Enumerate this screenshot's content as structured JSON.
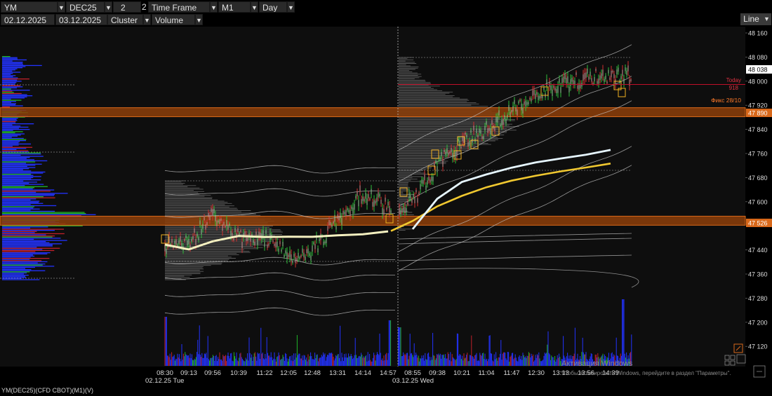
{
  "toolbar": {
    "symbol": "YM",
    "contract": "DEC25",
    "period_value": "2",
    "period_suffix": "2",
    "timeframe_label": "Time Frame",
    "interval": "M1",
    "range": "Day",
    "date_from": "02.12.2025",
    "date_to": "03.12.2025",
    "chart_mode": "Cluster",
    "cluster_value": "Volume",
    "style_button": "Line"
  },
  "price_axis": {
    "ticks": [
      "48 160",
      "48 080",
      "48 000",
      "47 920",
      "47 840",
      "47 760",
      "47 680",
      "47 600",
      "47 440",
      "47 360",
      "47 280",
      "47 200",
      "47 120"
    ],
    "current_price": "48 038",
    "level_upper": "47 890",
    "level_lower": "47 526"
  },
  "annotations": {
    "today_label": "Today",
    "today_value": "918",
    "fix_label": "Фикс 28/10"
  },
  "time_axis": {
    "labels": [
      "08:30",
      "09:13",
      "09:56",
      "10:39",
      "11:22",
      "12:05",
      "12:48",
      "13:31",
      "14:14",
      "14:57",
      "08:55",
      "09:38",
      "10:21",
      "11:04",
      "11:47",
      "12:30",
      "13:13",
      "13:56",
      "14:39"
    ],
    "date_labels": [
      "02.12.25 Tue",
      "03.12.25 Wed"
    ]
  },
  "watermark": {
    "title": "Активация Windows",
    "subtitle": "Чтобы активировать Windows, перейдите в раздел \"Параметры\"."
  },
  "status_bar": "YM(DEC25)(CFD CBOT)(M1)(V)",
  "colors": {
    "zone": "#b55a12",
    "vwap_white": "#e6f6ff",
    "vwap_yellow": "#f0c830",
    "today_line": "#c0102a",
    "fix_text": "#ff7a2a",
    "volume_blue": "#2233ff"
  },
  "chart_data": {
    "type": "line",
    "instrument": "YM DEC25",
    "timeframe": "M1",
    "ylim": [
      47240,
      48180
    ],
    "y_ticks": [
      48160,
      48080,
      48000,
      47920,
      47840,
      47760,
      47680,
      47600,
      47440,
      47360,
      47280,
      47200,
      47120
    ],
    "current_price": 48038,
    "zones": [
      {
        "label": "47 890",
        "low": 47882,
        "high": 47912
      },
      {
        "label": "47 526",
        "low": 47522,
        "high": 47552
      }
    ],
    "session_dates": [
      "02.12.25 Tue",
      "03.12.25 Wed"
    ],
    "series": [
      {
        "x": [
          "08:30",
          "09:13",
          "09:56",
          "10:39",
          "11:22",
          "12:05",
          "12:48",
          "13:31",
          "14:14",
          "14:57",
          "08:55",
          "09:38",
          "10:21",
          "11:04",
          "11:47",
          "12:30",
          "13:13",
          "13:56",
          "14:39"
        ],
        "values": [
          47460,
          47460,
          47560,
          47480,
          47480,
          47420,
          47440,
          47540,
          47630,
          47580,
          47600,
          47720,
          47800,
          47840,
          47900,
          47960,
          47990,
          48010,
          48020
        ]
      },
      {
        "x": [
          "08:30",
          "09:13",
          "09:56",
          "10:39",
          "11:22",
          "12:05",
          "12:48",
          "13:31",
          "14:14",
          "14:57",
          "08:55",
          "09:38",
          "10:21",
          "11:04",
          "11:47",
          "12:30",
          "13:13",
          "13:56",
          "14:39"
        ],
        "values": [
          47460,
          47440,
          47470,
          47485,
          47485,
          47482,
          47482,
          47485,
          47495,
          47505,
          47535,
          47585,
          47620,
          47650,
          47670,
          47685,
          47700,
          47712,
          47725
        ]
      },
      {
        "x": [
          "08:55",
          "09:38",
          "10:21",
          "11:04",
          "11:47",
          "12:30",
          "13:13",
          "13:56",
          "14:39"
        ],
        "values": [
          47510,
          47610,
          47665,
          47690,
          47715,
          47730,
          47745,
          47757,
          47772
        ]
      }
    ]
  }
}
